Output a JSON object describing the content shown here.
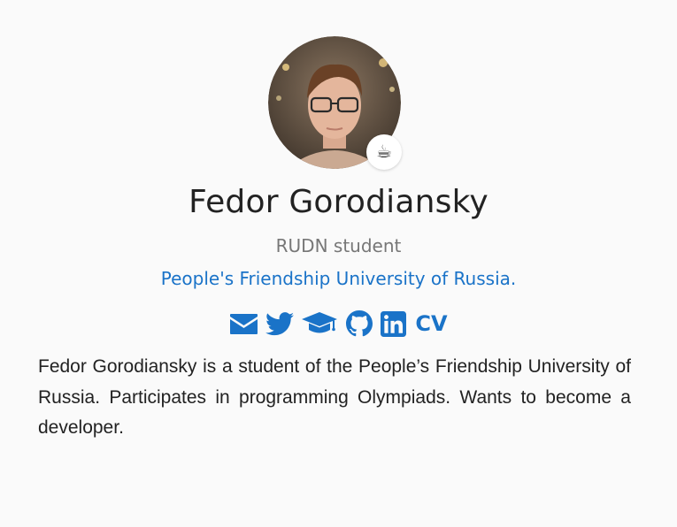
{
  "profile": {
    "name": "Fedor Gorodiansky",
    "role": "RUDN student",
    "organization": "People's Friendship University of Russia.",
    "status_emoji": "☕",
    "avatar_icon": "person-photo"
  },
  "social_links": [
    {
      "name": "email",
      "icon": "envelope-icon"
    },
    {
      "name": "twitter",
      "icon": "twitter-icon"
    },
    {
      "name": "scholar",
      "icon": "graduation-cap-icon"
    },
    {
      "name": "github",
      "icon": "github-icon"
    },
    {
      "name": "linkedin",
      "icon": "linkedin-icon"
    },
    {
      "name": "cv",
      "label": "CV"
    }
  ],
  "bio": "Fedor Gorodiansky is a student of the People’s Friendship University of Russia. Participates in programming Olympiads. Wants to become a developer.",
  "colors": {
    "accent": "#1a73c8",
    "text": "#222222",
    "muted": "#777777",
    "background": "#fafafa"
  }
}
